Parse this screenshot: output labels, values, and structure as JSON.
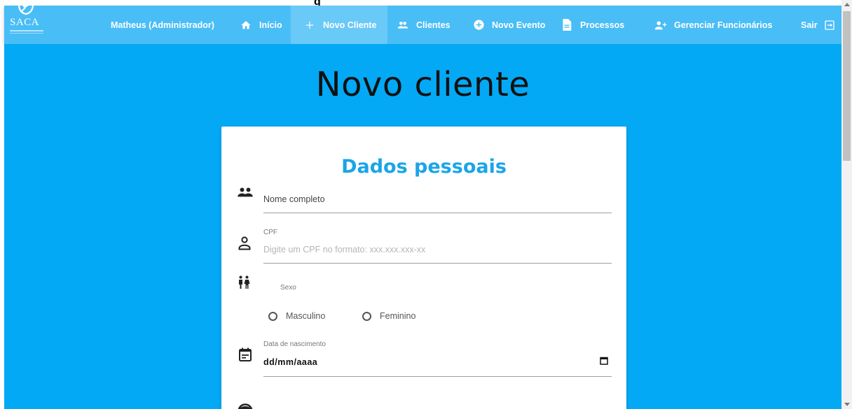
{
  "nav": {
    "logo_text": "SACA",
    "user_label": "Matheus (Administrador)",
    "items": [
      {
        "label": "Início",
        "icon": "home-icon"
      },
      {
        "label": "Novo Cliente",
        "icon": "plus-icon"
      },
      {
        "label": "Clientes",
        "icon": "people-icon"
      },
      {
        "label": "Novo Evento",
        "icon": "add-circle-icon"
      },
      {
        "label": "Processos",
        "icon": "document-icon"
      },
      {
        "label": "Gerenciar Funcionários",
        "icon": "person-add-icon"
      },
      {
        "label": "Sair",
        "icon": "exit-icon"
      }
    ]
  },
  "page": {
    "title": "Novo cliente"
  },
  "form": {
    "section_title": "Dados pessoais",
    "nome": {
      "placeholder": "Nome completo",
      "icon": "group-icon"
    },
    "cpf": {
      "label": "CPF",
      "hint": "Digite um CPF no formato: xxx.xxx.xxx-xx",
      "icon": "person-outline-icon"
    },
    "sexo": {
      "label": "Sexo",
      "icon": "wc-icon",
      "options": [
        "Masculino",
        "Feminino"
      ]
    },
    "nascimento": {
      "label": "Data de nascimento",
      "value": "dd/mm/aaaa",
      "icon": "event-note-icon",
      "picker_icon": "calendar-icon"
    },
    "next_icon": "face-icon"
  },
  "colors": {
    "navbar": "#49bdf6",
    "background": "#03a9f4",
    "accent_title": "#1aa5e8"
  }
}
